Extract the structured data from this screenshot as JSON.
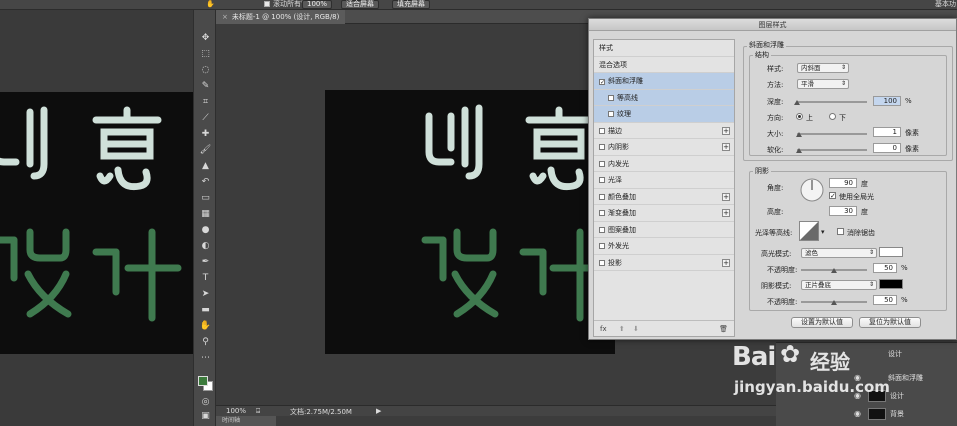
{
  "options_bar": {
    "scroll_all_windows": "滚动所有窗口",
    "zoom_value": "100%",
    "fit_screen_button": "适合屏幕",
    "fill_screen_button": "填充屏幕",
    "right_label": "基本功"
  },
  "document": {
    "tab_close": "×",
    "tab_title": "未标题-1 @ 100% (设计, RGB/8)",
    "artwork_top": "创意",
    "artwork_bottom": "设计",
    "text_color": "#cfe0d9",
    "green_color": "#3f7a4f"
  },
  "status_bar": {
    "zoom": "100%",
    "doc_info": "文档:2.75M/2.50M",
    "bottom_tab": "时间轴"
  },
  "layers_panel": {
    "rows": [
      {
        "label": "设计"
      },
      {
        "label": "斜面和浮雕"
      },
      {
        "label": "设计"
      },
      {
        "label": "背景"
      }
    ]
  },
  "dialog": {
    "title": "图层样式",
    "style_list": {
      "header": "样式",
      "blend_options": "混合选项",
      "items": [
        {
          "label": "斜面和浮雕",
          "checked": true,
          "selected": true,
          "plus": false,
          "sub": false
        },
        {
          "label": "等高线",
          "checked": false,
          "selected": true,
          "plus": false,
          "sub": true
        },
        {
          "label": "纹理",
          "checked": false,
          "selected": true,
          "plus": false,
          "sub": true
        },
        {
          "label": "描边",
          "checked": false,
          "selected": false,
          "plus": true,
          "sub": false
        },
        {
          "label": "内阴影",
          "checked": false,
          "selected": false,
          "plus": true,
          "sub": false
        },
        {
          "label": "内发光",
          "checked": false,
          "selected": false,
          "plus": false,
          "sub": false
        },
        {
          "label": "光泽",
          "checked": false,
          "selected": false,
          "plus": false,
          "sub": false
        },
        {
          "label": "颜色叠加",
          "checked": false,
          "selected": false,
          "plus": true,
          "sub": false
        },
        {
          "label": "渐变叠加",
          "checked": false,
          "selected": false,
          "plus": true,
          "sub": false
        },
        {
          "label": "图案叠加",
          "checked": false,
          "selected": false,
          "plus": false,
          "sub": false
        },
        {
          "label": "外发光",
          "checked": false,
          "selected": false,
          "plus": false,
          "sub": false
        },
        {
          "label": "投影",
          "checked": false,
          "selected": false,
          "plus": true,
          "sub": false
        }
      ],
      "footer": "fx"
    },
    "bevel": {
      "section_title": "斜面和浮雕",
      "structure_title": "结构",
      "style_label": "样式:",
      "style_value": "内斜面",
      "method_label": "方法:",
      "method_value": "平滑",
      "depth_label": "深度:",
      "depth_value": "100",
      "depth_unit": "%",
      "depth_level": 0.0,
      "direction_label": "方向:",
      "dir_up": "上",
      "dir_down": "下",
      "size_label": "大小:",
      "size_value": "1",
      "size_unit": "像素",
      "soften_label": "软化:",
      "soften_value": "0",
      "soften_unit": "像素"
    },
    "shading": {
      "title": "阴影",
      "angle_label": "角度:",
      "angle_value": "90",
      "angle_unit": "度",
      "global_light": "使用全局光",
      "altitude_label": "高度:",
      "altitude_value": "30",
      "altitude_unit": "度",
      "gloss_contour_label": "光泽等高线:",
      "anti_alias": "消除锯齿",
      "highlight_mode_label": "高光模式:",
      "highlight_mode_value": "滤色",
      "highlight_opacity_label": "不透明度:",
      "highlight_opacity_value": "50",
      "shadow_mode_label": "阴影模式:",
      "shadow_mode_value": "正片叠底",
      "shadow_opacity_label": "不透明度:",
      "shadow_opacity_value": "50",
      "percent": "%"
    },
    "buttons": {
      "set_default": "设置为默认值",
      "reset_default": "复位为默认值"
    }
  },
  "watermark": {
    "brand": "Bai",
    "brand2": "经验",
    "url": "jingyan.baidu.com"
  }
}
